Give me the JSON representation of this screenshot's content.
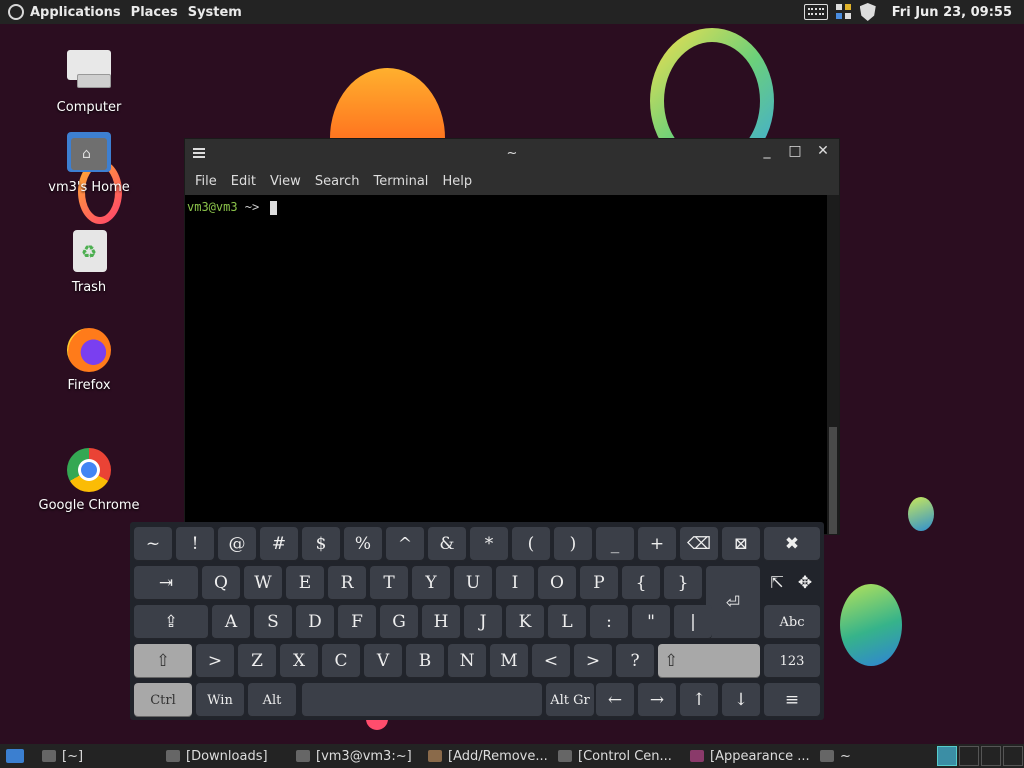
{
  "top_panel": {
    "menus": [
      "Applications",
      "Places",
      "System"
    ],
    "clock": "Fri Jun 23, 09:55"
  },
  "desktop_icons": [
    {
      "label": "Computer",
      "icon": "computer-icon"
    },
    {
      "label": "vm3's Home",
      "icon": "home-folder-icon"
    },
    {
      "label": "Trash",
      "icon": "trash-icon"
    },
    {
      "label": "Firefox",
      "icon": "firefox-icon"
    },
    {
      "label": "Google Chrome",
      "icon": "chrome-icon"
    }
  ],
  "terminal": {
    "title": "~",
    "menu": [
      "File",
      "Edit",
      "View",
      "Search",
      "Terminal",
      "Help"
    ],
    "prompt_user": "vm3@vm3",
    "prompt_path": " ~> "
  },
  "keyboard": {
    "row1": [
      "~",
      "!",
      "@",
      "#",
      "$",
      "%",
      "^",
      "&",
      "*",
      "(",
      ")",
      "_",
      "+"
    ],
    "row1_special": [
      "⌫",
      "⊠",
      "✖"
    ],
    "tab": "⇥",
    "row2": [
      "Q",
      "W",
      "E",
      "R",
      "T",
      "Y",
      "U",
      "I",
      "O",
      "P",
      "{",
      "}"
    ],
    "row2_special": [
      "⇱",
      "✥"
    ],
    "caps": "⇪",
    "row3": [
      "A",
      "S",
      "D",
      "F",
      "G",
      "H",
      "J",
      "K",
      "L",
      ":",
      "\"",
      "|"
    ],
    "enter": "⏎",
    "abc": "Abc",
    "shift": "⇧",
    "row4": [
      ">",
      "Z",
      "X",
      "C",
      "V",
      "B",
      "N",
      "M",
      "<",
      ">",
      "?"
    ],
    "num": "123",
    "ctrl": "Ctrl",
    "win": "Win",
    "alt": "Alt",
    "altgr": "Alt Gr",
    "arrows": [
      "←",
      "→",
      "↑",
      "↓"
    ],
    "menu": "≡"
  },
  "taskbar": {
    "tasks": [
      "[~]",
      "[Downloads]",
      "[vm3@vm3:~]",
      "[Add/Remove...",
      "[Control Cen...",
      "[Appearance ...",
      "~"
    ]
  }
}
